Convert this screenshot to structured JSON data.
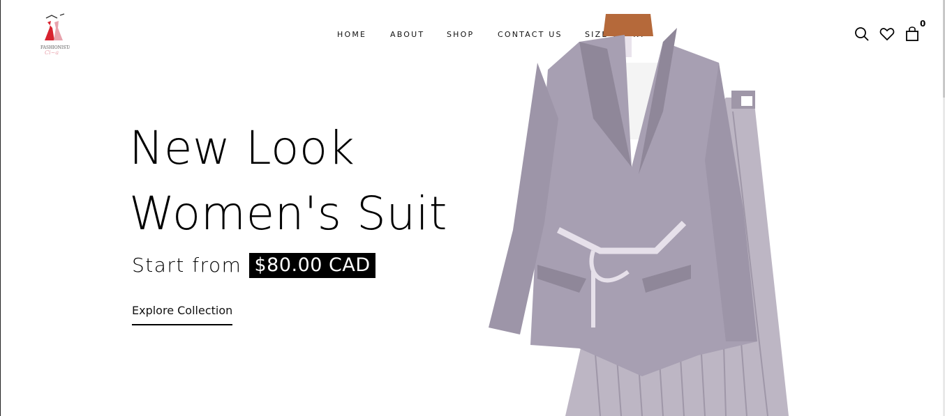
{
  "brand": {
    "logo_text": "FASHIONISTA",
    "logo_icon": "dress-hanger-logo"
  },
  "nav": {
    "items": [
      {
        "label": "HOME"
      },
      {
        "label": "ABOUT"
      },
      {
        "label": "SHOP"
      },
      {
        "label": "CONTACT US"
      },
      {
        "label": "SIZE CHART"
      }
    ]
  },
  "header_icons": {
    "search": "search-icon",
    "wishlist": "heart-icon",
    "cart": "shopping-bag-icon",
    "cart_count": "0"
  },
  "hero": {
    "title_line1": "New Look",
    "title_line2": "Women's Suit",
    "price_prefix": "Start from",
    "price": "$80.00 CAD",
    "cta": "Explore Collection"
  },
  "colors": {
    "accent": "#000000",
    "suit": "#a79fb2",
    "logo_red": "#d8232f",
    "logo_pink": "#e8a3ad"
  }
}
